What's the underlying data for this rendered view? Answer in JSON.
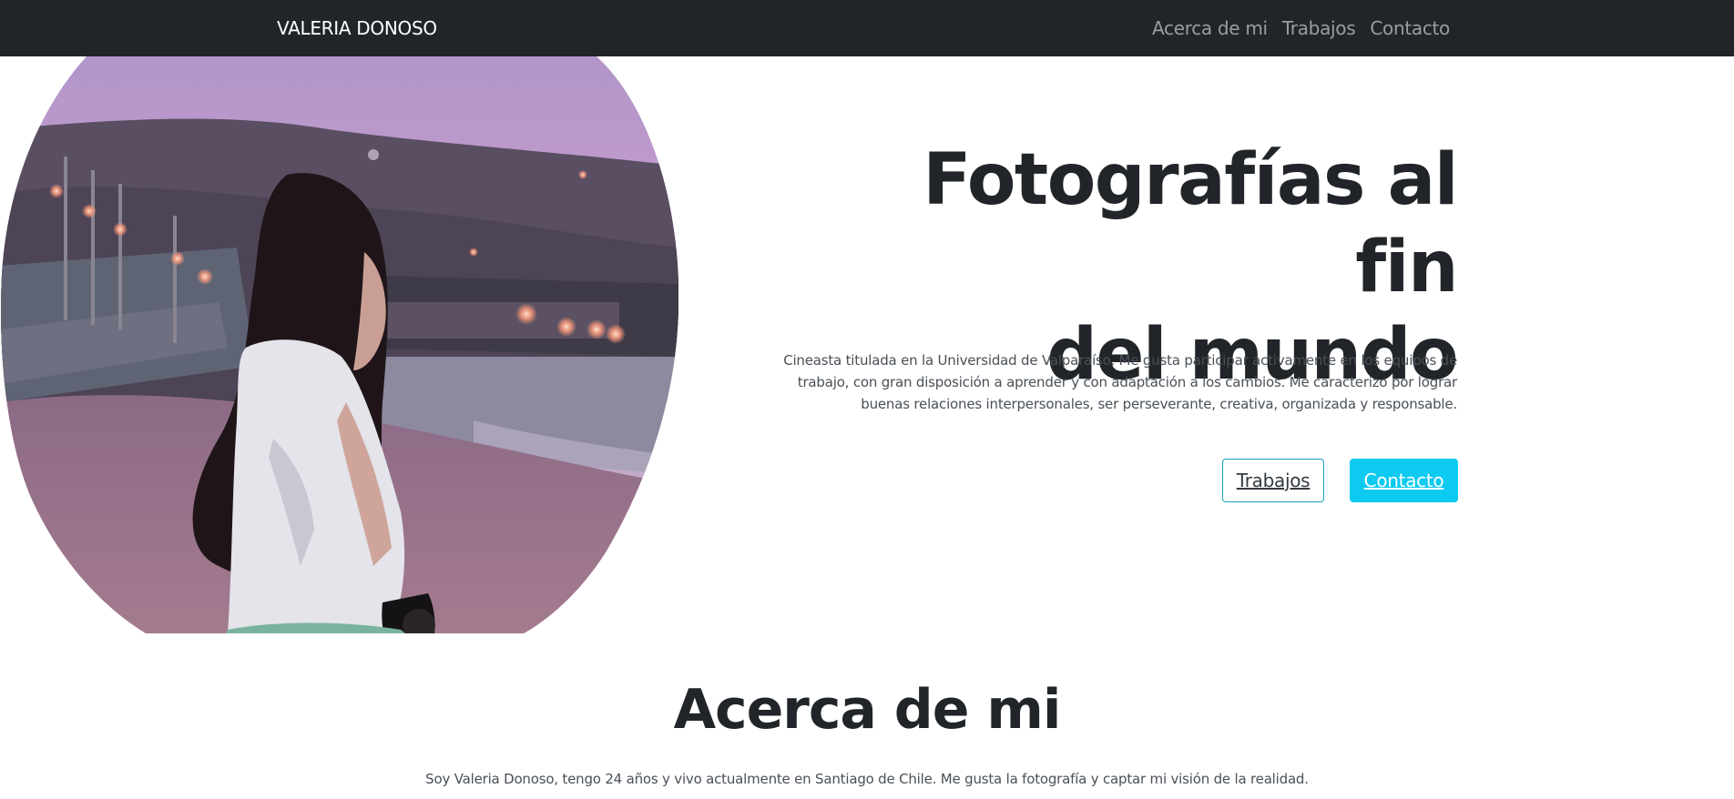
{
  "navbar": {
    "brand": "VALERIA DONOSO",
    "links": [
      "Acerca de mi",
      "Trabajos",
      "Contacto"
    ],
    "background": "#212529"
  },
  "hero": {
    "title_line1": "Fotografías al fin",
    "title_line2": "del mundo",
    "description_line1": "Cineasta titulada en la Universidad de Valparaíso. Me gusta participar activamente en los equipos de",
    "description_line2": "trabajo, con gran disposición a aprender y con adaptación a los cambios. Me caracterizo por lograr",
    "description_line3": "buenas relaciones interpersonales, ser perseverante, creativa, organizada y responsable.",
    "buttons": {
      "secondary_label": "Trabajos",
      "primary_label": "Contacto"
    },
    "accent_color": "#0dcaf0"
  },
  "about": {
    "title": "Acerca de mi",
    "text": "Soy Valeria Donoso, tengo 24 años y vivo actualmente en Santiago de Chile. Me gusta la fotografía y captar mi visión de la realidad."
  }
}
